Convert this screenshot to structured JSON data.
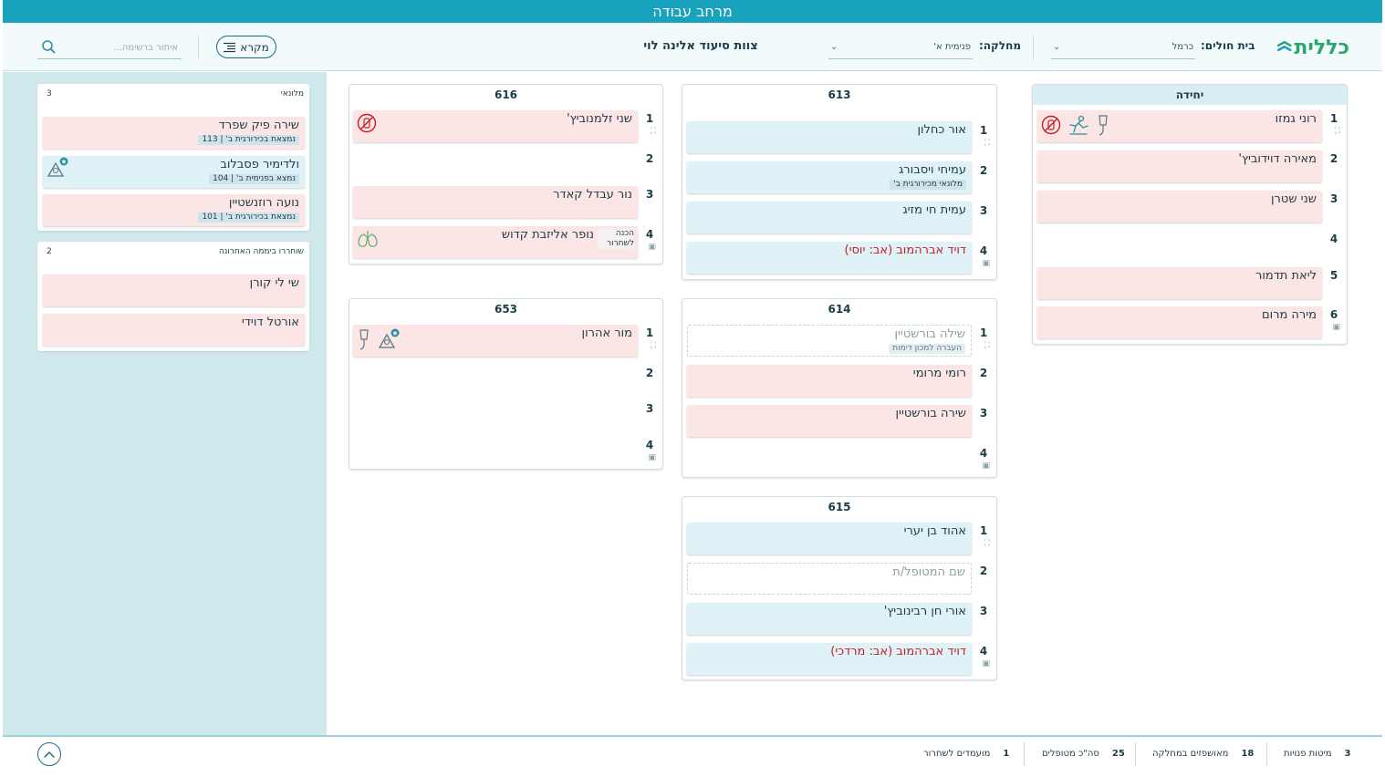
{
  "window": {
    "title": "מרחב עבודה"
  },
  "toolbar": {
    "logo_text": "כללית",
    "hospital_label": "בית חולים:",
    "hospital_value": "כרמל",
    "department_label": "מחלקה:",
    "department_value": "פנימית א'",
    "team_title": "צוות סיעוד אלינה לוי",
    "legend_label": "מקרא",
    "search_placeholder": "איתור ברשימה..."
  },
  "colors": {
    "header": "#19a2bd",
    "accent": "#1d6b80",
    "pink_card": "#fbe5e5",
    "blue_card": "#dff2f8",
    "alert_red": "#c61f23",
    "logo_green": "#2ba56f"
  },
  "rooms": {
    "unit": {
      "title": "יחידה",
      "beds": [
        {
          "num": "1",
          "name": "רוני גמזו",
          "icons": [
            "iv-drip-icon",
            "fall-risk-icon",
            "no-food-icon"
          ]
        },
        {
          "num": "2",
          "name": "מאירה דוידוביץ'"
        },
        {
          "num": "3",
          "name": "שני שטרן"
        },
        {
          "num": "4"
        },
        {
          "num": "5",
          "name": "ליאת תדמור"
        },
        {
          "num": "6",
          "name": "מירה מרום"
        }
      ]
    },
    "r613": {
      "title": "613",
      "beds": [
        {
          "num": "1",
          "name": "אור כחלון"
        },
        {
          "num": "2",
          "name": "עמיחי ויסבורג",
          "sub": "מלונאי מכירורגית ב'"
        },
        {
          "num": "3",
          "name": "עמית חי מזיג"
        },
        {
          "num": "4",
          "name": "דויד אברהמוב (אב: יוסי)"
        }
      ]
    },
    "r616": {
      "title": "616",
      "beds": [
        {
          "num": "1",
          "name": "שני זלמנוביץ'"
        },
        {
          "num": "2"
        },
        {
          "num": "3",
          "name": "נור עבדל קאדר"
        },
        {
          "num": "4",
          "name": "נופר אליזבת קדוש",
          "note": "הכנה לשחרור"
        }
      ]
    },
    "r614": {
      "title": "614",
      "beds": [
        {
          "num": "1",
          "name": "שילה בורשטיין",
          "sub": "העברה למכון דימות"
        },
        {
          "num": "2",
          "name": "רומי מרומי"
        },
        {
          "num": "3",
          "name": "שירה בורשטיין"
        },
        {
          "num": "4"
        }
      ]
    },
    "r653": {
      "title": "653",
      "beds": [
        {
          "num": "1",
          "name": "מור אהרון"
        },
        {
          "num": "2"
        },
        {
          "num": "3"
        },
        {
          "num": "4"
        }
      ]
    },
    "r615": {
      "title": "615",
      "beds": [
        {
          "num": "1",
          "name": "אהוד בן יערי"
        },
        {
          "num": "2",
          "name": "שם המטופל/ת"
        },
        {
          "num": "3",
          "name": "אורי חן רבינוביץ'"
        },
        {
          "num": "4",
          "name": "דויד אברהמוב (אב: מרדכי)"
        }
      ]
    }
  },
  "side": {
    "boarders": {
      "title": "מלונאי",
      "count": "3",
      "items": [
        {
          "name": "שירה פיק שפרד",
          "sub": "נמצאת בכירורגית ב' | 113"
        },
        {
          "name": "ולדימיר פסבלוב",
          "sub": "נמצא בפנימית ב' | 104"
        },
        {
          "name": "נועה רוזנשטיין",
          "sub": "נמצאת בכירורגית ב' | 101"
        }
      ]
    },
    "discharged": {
      "title": "שוחררו ביממה האחרונה",
      "count": "2",
      "items": [
        {
          "name": "שי לי קורן"
        },
        {
          "name": "אורטל דוידי"
        }
      ]
    }
  },
  "footer": {
    "stats": [
      {
        "label": "מיטות פנויות",
        "value": "3"
      },
      {
        "label": "מאושפזים במחלקה",
        "value": "18"
      },
      {
        "label": "סה\"כ מטופלים",
        "value": "25"
      },
      {
        "label": "מועמדים לשחרור",
        "value": "1"
      }
    ]
  }
}
